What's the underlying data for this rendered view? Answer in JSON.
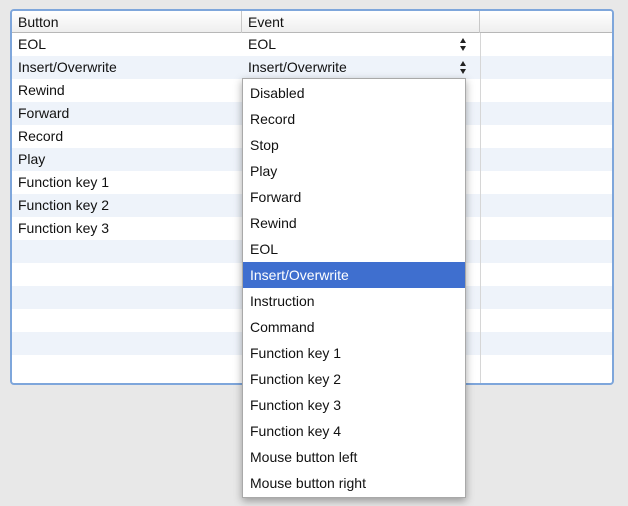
{
  "table": {
    "columns": [
      "Button",
      "Event",
      ""
    ],
    "rows": [
      {
        "button": "EOL",
        "event": "EOL"
      },
      {
        "button": "Insert/Overwrite",
        "event": "Insert/Overwrite"
      },
      {
        "button": "Rewind",
        "event": ""
      },
      {
        "button": "Forward",
        "event": ""
      },
      {
        "button": "Record",
        "event": ""
      },
      {
        "button": "Play",
        "event": ""
      },
      {
        "button": "Function key 1",
        "event": ""
      },
      {
        "button": "Function key 2",
        "event": ""
      },
      {
        "button": "Function key 3",
        "event": ""
      },
      {
        "button": "",
        "event": ""
      },
      {
        "button": "",
        "event": ""
      },
      {
        "button": "",
        "event": ""
      },
      {
        "button": "",
        "event": ""
      },
      {
        "button": "",
        "event": ""
      },
      {
        "button": "",
        "event": ""
      }
    ]
  },
  "dropdown": {
    "selected": "Insert/Overwrite",
    "options": [
      "Disabled",
      "Record",
      "Stop",
      "Play",
      "Forward",
      "Rewind",
      "EOL",
      "Insert/Overwrite",
      "Instruction",
      "Command",
      "Function key 1",
      "Function key 2",
      "Function key 3",
      "Function key 4",
      "Mouse button left",
      "Mouse button right"
    ]
  },
  "colors": {
    "frame_border": "#7ea6db",
    "row_alt": "#eef3fa",
    "selection": "#3f6fcf"
  },
  "icons": {
    "stepper": "up-down-stepper-icon"
  }
}
